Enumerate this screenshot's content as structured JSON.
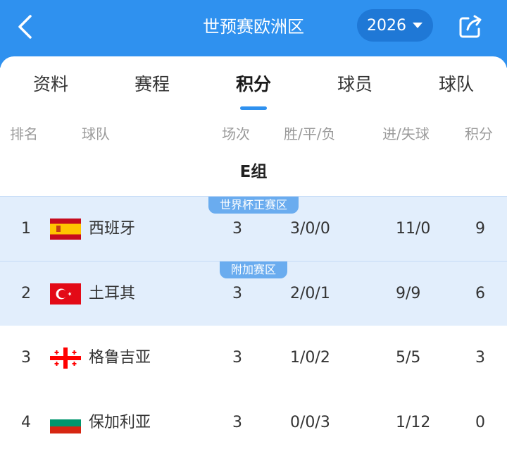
{
  "header": {
    "title": "世预赛欧洲区",
    "year": "2026"
  },
  "tabs": [
    {
      "label": "资料",
      "active": false
    },
    {
      "label": "赛程",
      "active": false
    },
    {
      "label": "积分",
      "active": true
    },
    {
      "label": "球员",
      "active": false
    },
    {
      "label": "球队",
      "active": false
    }
  ],
  "columns": {
    "rank": "排名",
    "team": "球队",
    "played": "场次",
    "wdl": "胜/平/负",
    "goals": "进/失球",
    "points": "积分"
  },
  "group": "E组",
  "standings": [
    {
      "rank": "1",
      "team": "西班牙",
      "flag": "spain-flag",
      "played": "3",
      "wdl": "3/0/0",
      "goals": "11/0",
      "points": "9",
      "zone": "世界杯正赛区"
    },
    {
      "rank": "2",
      "team": "土耳其",
      "flag": "turkey-flag",
      "played": "3",
      "wdl": "2/0/1",
      "goals": "9/9",
      "points": "6",
      "zone": "附加赛区"
    },
    {
      "rank": "3",
      "team": "格鲁吉亚",
      "flag": "georgia-flag",
      "played": "3",
      "wdl": "1/0/2",
      "goals": "5/5",
      "points": "3",
      "zone": ""
    },
    {
      "rank": "4",
      "team": "保加利亚",
      "flag": "bulgaria-flag",
      "played": "3",
      "wdl": "0/0/3",
      "goals": "1/12",
      "points": "0",
      "zone": ""
    }
  ],
  "colors": {
    "header_blue": "#2f91ef",
    "year_pill": "#1f78d6",
    "highlight_row": "#e2eefc",
    "zone_tag": "#6aacef"
  }
}
